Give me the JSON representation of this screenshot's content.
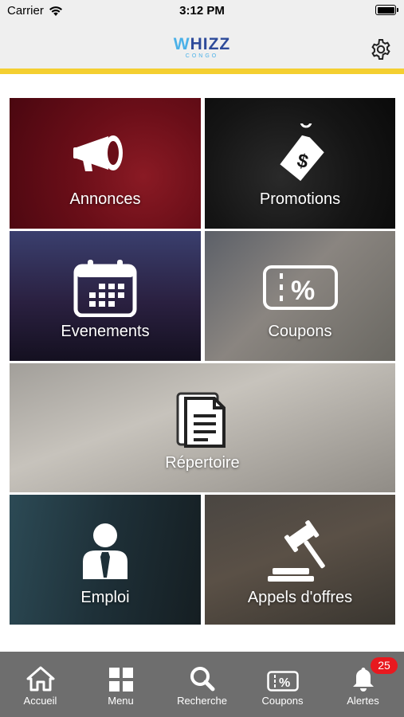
{
  "status_bar": {
    "carrier": "Carrier",
    "time": "3:12 PM"
  },
  "header": {
    "logo_main": "WHIZZ",
    "logo_sub": "CONGO",
    "settings_icon": "gear-icon"
  },
  "accent_colors": {
    "yellow_bar": "#f4cf31",
    "tab_bar": "#6e6e6e",
    "badge": "#e8191f",
    "logo_blue": "#2d4a9a"
  },
  "tiles": [
    {
      "label": "Annonces",
      "icon": "megaphone-icon"
    },
    {
      "label": "Promotions",
      "icon": "price-tag-icon"
    },
    {
      "label": "Evenements",
      "icon": "calendar-icon"
    },
    {
      "label": "Coupons",
      "icon": "coupon-icon"
    },
    {
      "label": "Répertoire",
      "icon": "document-icon"
    },
    {
      "label": "Emploi",
      "icon": "businessman-icon"
    },
    {
      "label": "Appels d'offres",
      "icon": "gavel-icon"
    }
  ],
  "tab_bar": {
    "items": [
      {
        "label": "Accueil",
        "icon": "home-icon"
      },
      {
        "label": "Menu",
        "icon": "grid-icon"
      },
      {
        "label": "Recherche",
        "icon": "search-icon"
      },
      {
        "label": "Coupons",
        "icon": "coupon-icon"
      },
      {
        "label": "Alertes",
        "icon": "bell-icon"
      }
    ],
    "alerts_badge": "25"
  }
}
